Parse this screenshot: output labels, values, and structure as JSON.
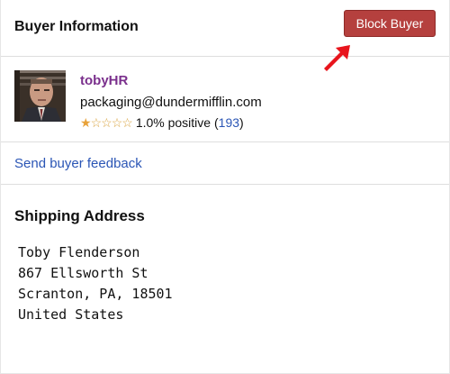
{
  "header": {
    "title": "Buyer Information",
    "block_button_label": "Block Buyer"
  },
  "buyer": {
    "username": "tobyHR",
    "email": "packaging@dundermifflin.com",
    "rating": {
      "filled_stars": 1,
      "total_stars": 5,
      "percent_text": "1.0% positive",
      "open_paren": "(",
      "count": "193",
      "close_paren": ")"
    }
  },
  "feedback_link": "Send buyer feedback",
  "shipping": {
    "title": "Shipping Address",
    "lines": [
      "Toby Flenderson",
      "867 Ellsworth St",
      "Scranton, PA, 18501",
      "United States"
    ]
  },
  "colors": {
    "block_button": "#b5403e",
    "username": "#7a2f8c",
    "link": "#2a55b5",
    "arrow": "#e8141c",
    "star": "#e8a23a"
  },
  "icons": [
    "avatar-photo",
    "star-icon",
    "red-arrow-annotation"
  ]
}
